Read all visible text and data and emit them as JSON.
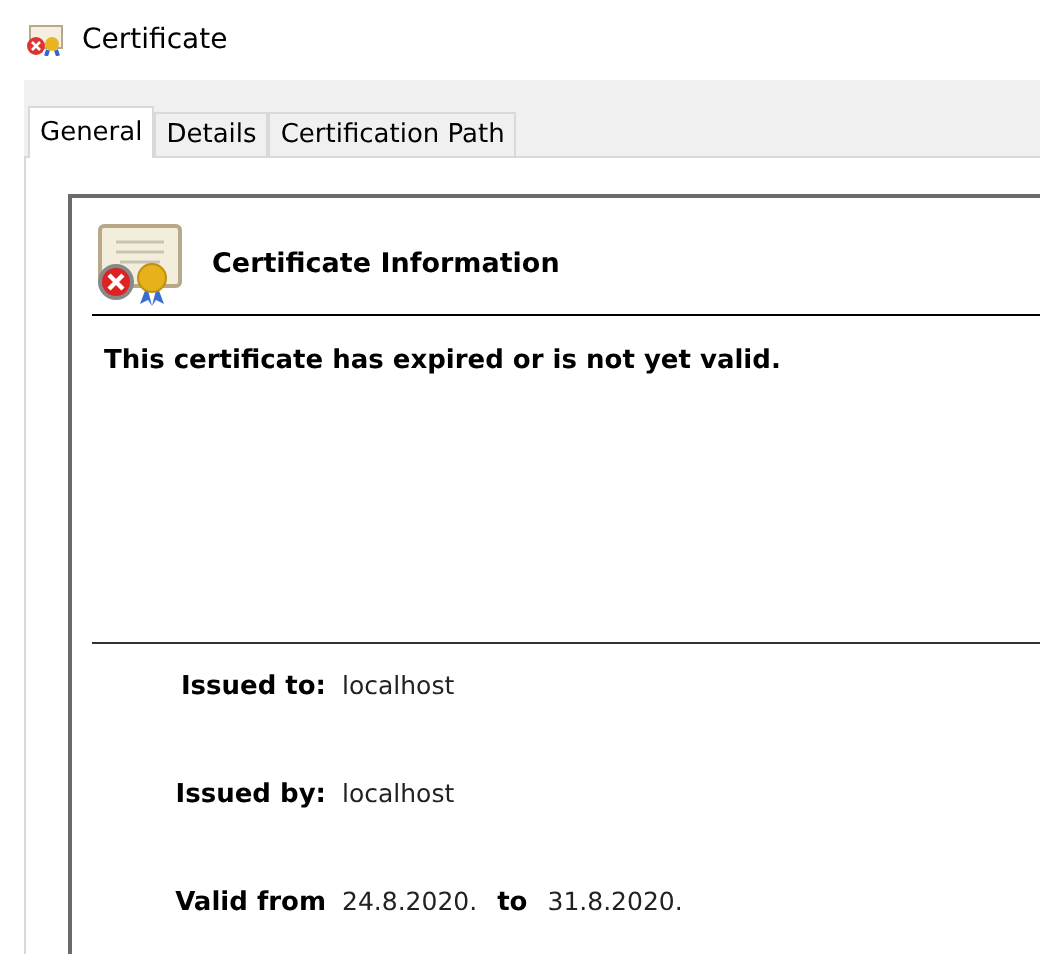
{
  "window": {
    "title": "Certificate"
  },
  "tabs": [
    {
      "label": "General",
      "selected": true
    },
    {
      "label": "Details",
      "selected": false
    },
    {
      "label": "Certification Path",
      "selected": false
    }
  ],
  "certificate_info": {
    "heading": "Certificate Information",
    "status": "This certificate has expired or is not yet valid.",
    "issued_to_label": "Issued to:",
    "issued_to": "localhost",
    "issued_by_label": "Issued by:",
    "issued_by": "localhost",
    "valid_from_label": "Valid from",
    "valid_from": "24.8.2020.",
    "to_label": "to",
    "valid_to": "31.8.2020."
  }
}
